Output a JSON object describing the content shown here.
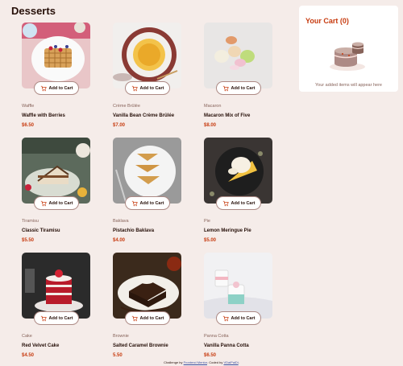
{
  "page": {
    "title": "Desserts"
  },
  "button": {
    "add_to_cart": "Add to Cart"
  },
  "products": [
    {
      "category": "Waffle",
      "name": "Waffle with Berries",
      "price": "$6.50",
      "image": "waffle"
    },
    {
      "category": "Crème Brûlée",
      "name": "Vanilla Bean Crème Brûlée",
      "price": "$7.00",
      "image": "creme-brulee"
    },
    {
      "category": "Macaron",
      "name": "Macaron Mix of Five",
      "price": "$8.00",
      "image": "macaron"
    },
    {
      "category": "Tiramisu",
      "name": "Classic Tiramisu",
      "price": "$5.50",
      "image": "tiramisu"
    },
    {
      "category": "Baklava",
      "name": "Pistachio Baklava",
      "price": "$4.00",
      "image": "baklava"
    },
    {
      "category": "Pie",
      "name": "Lemon Meringue Pie",
      "price": "$5.00",
      "image": "pie"
    },
    {
      "category": "Cake",
      "name": "Red Velvet Cake",
      "price": "$4.50",
      "image": "cake"
    },
    {
      "category": "Brownie",
      "name": "Salted Caramel Brownie",
      "price": "5.50",
      "image": "brownie"
    },
    {
      "category": "Panna Cotta",
      "name": "Vanilla Panna Cotta",
      "price": "$6.50",
      "image": "panna-cotta"
    }
  ],
  "cart": {
    "title": "Your Cart (0)",
    "empty_message": "Your added items will appear here"
  },
  "footer": {
    "prefix": "Challenge by",
    "challenge_link": "Frontend Mentor",
    "middle": ". Coded by",
    "author_link": "VDaiPaiDi",
    "suffix": "."
  },
  "colors": {
    "accent": "#c73b0f",
    "background": "#f5ece9",
    "text": "#260f08"
  }
}
